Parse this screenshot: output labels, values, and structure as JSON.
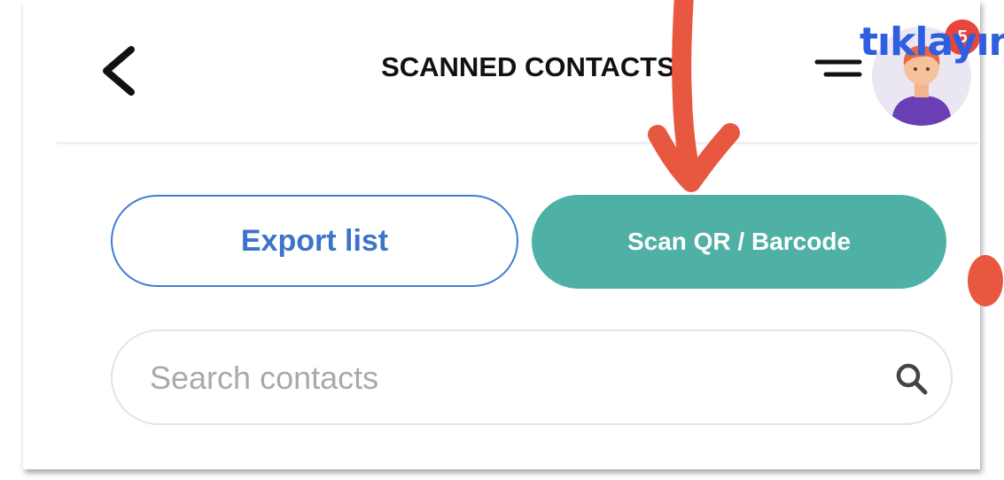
{
  "header": {
    "title": "SCANNED CONTACTS",
    "back_icon": "chevron-left-icon",
    "menu_icon": "filter-menu-icon",
    "notification_count": "5"
  },
  "actions": {
    "export_label": "Export list",
    "scan_label": "Scan QR / Barcode"
  },
  "search": {
    "placeholder": "Search contacts",
    "value": "",
    "icon": "search-icon"
  },
  "annotation": {
    "text": "tıklayın",
    "color": "#e8573f",
    "text_color": "#2f5fe0"
  },
  "colors": {
    "accent_teal": "#4fb0a6",
    "accent_blue": "#3d7fd1",
    "badge_red": "#e8463a"
  }
}
